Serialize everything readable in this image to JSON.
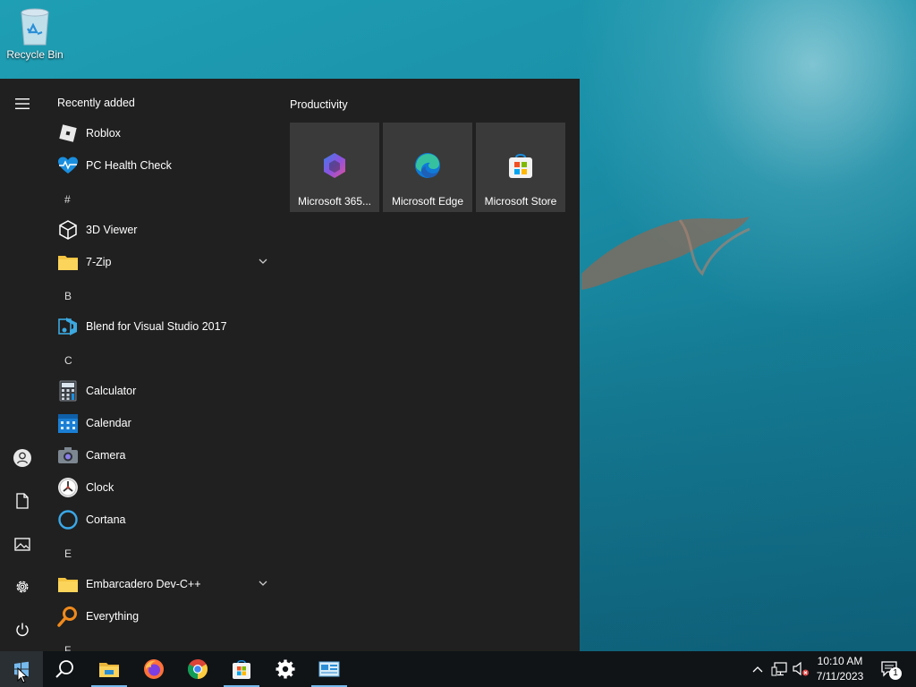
{
  "desktop": {
    "recycle_bin_label": "Recycle Bin"
  },
  "start_menu": {
    "recently_added_label": "Recently added",
    "recent_apps": [
      {
        "name": "Roblox",
        "icon": "roblox-icon"
      },
      {
        "name": "PC Health Check",
        "icon": "pc-health-check-icon"
      }
    ],
    "groups": [
      {
        "letter": "#",
        "apps": [
          {
            "name": "3D Viewer",
            "icon": "3d-viewer-icon"
          },
          {
            "name": "7-Zip",
            "icon": "folder-icon",
            "expandable": true
          }
        ]
      },
      {
        "letter": "B",
        "apps": [
          {
            "name": "Blend for Visual Studio 2017",
            "icon": "blend-icon"
          }
        ]
      },
      {
        "letter": "C",
        "apps": [
          {
            "name": "Calculator",
            "icon": "calculator-icon"
          },
          {
            "name": "Calendar",
            "icon": "calendar-icon"
          },
          {
            "name": "Camera",
            "icon": "camera-icon"
          },
          {
            "name": "Clock",
            "icon": "clock-icon"
          },
          {
            "name": "Cortana",
            "icon": "cortana-icon"
          }
        ]
      },
      {
        "letter": "E",
        "apps": [
          {
            "name": "Embarcadero Dev-C++",
            "icon": "folder-icon",
            "expandable": true
          },
          {
            "name": "Everything",
            "icon": "everything-icon"
          }
        ]
      },
      {
        "letter": "F",
        "apps": []
      }
    ],
    "tiles_group_title": "Productivity",
    "tiles": [
      {
        "label": "Microsoft 365...",
        "icon": "microsoft-365-icon"
      },
      {
        "label": "Microsoft Edge",
        "icon": "edge-icon"
      },
      {
        "label": "Microsoft Store",
        "icon": "store-icon"
      }
    ],
    "rail": [
      "hamburger-icon",
      "user-icon",
      "documents-icon",
      "pictures-icon",
      "settings-icon",
      "power-icon"
    ]
  },
  "taskbar": {
    "pinned": [
      "windows-start-icon",
      "search-icon",
      "file-explorer-icon",
      "firefox-icon",
      "chrome-icon",
      "store-icon",
      "settings-icon",
      "control-panel-icon"
    ],
    "clock_time": "10:10 AM",
    "clock_date": "7/11/2023",
    "notification_count": "1"
  },
  "colors": {
    "menu_bg": "#202020",
    "tile_bg": "#3a3a3a",
    "taskbar_bg": "#101417",
    "accent": "#76b9ed"
  }
}
